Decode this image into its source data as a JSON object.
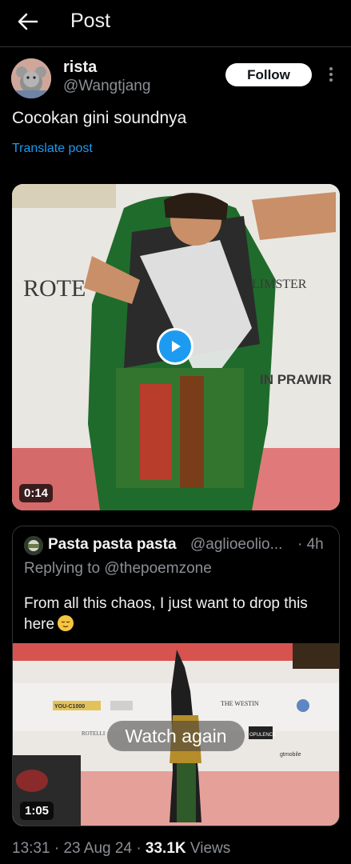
{
  "header": {
    "title": "Post",
    "back_icon": "arrow-left-icon"
  },
  "author": {
    "name": "rista",
    "handle": "@Wangtjang",
    "follow_label": "Follow",
    "more_icon": "more-vertical-icon"
  },
  "post": {
    "text": "Cocokan gini soundnya",
    "translate_label": "Translate post"
  },
  "video": {
    "duration": "0:14",
    "play_icon": "play-icon",
    "signage": [
      "ROTE",
      "LIMSTER",
      "IN PRAWIR"
    ]
  },
  "quote": {
    "name": "Pasta pasta pasta",
    "handle": "@aglioeolio...",
    "time": "· 4h",
    "replying_to": "Replying to @thepoemzone",
    "text": "From all this chaos, I just want to drop this here",
    "video": {
      "duration": "1:05",
      "watch_again_label": "Watch again",
      "signage": [
        "THE WESTIN",
        "OPULENCE",
        "gtmobile",
        "YOU-C1000",
        "ROTELLI"
      ]
    }
  },
  "footer": {
    "time": "13:31",
    "date": "23 Aug 24",
    "views_count": "33.1K",
    "views_label": "Views",
    "sep": "·"
  },
  "colors": {
    "background": "#000000",
    "accent": "#1d9bf0",
    "muted": "#8b8f94",
    "text": "#e7e9ea",
    "border": "#2f3336"
  }
}
